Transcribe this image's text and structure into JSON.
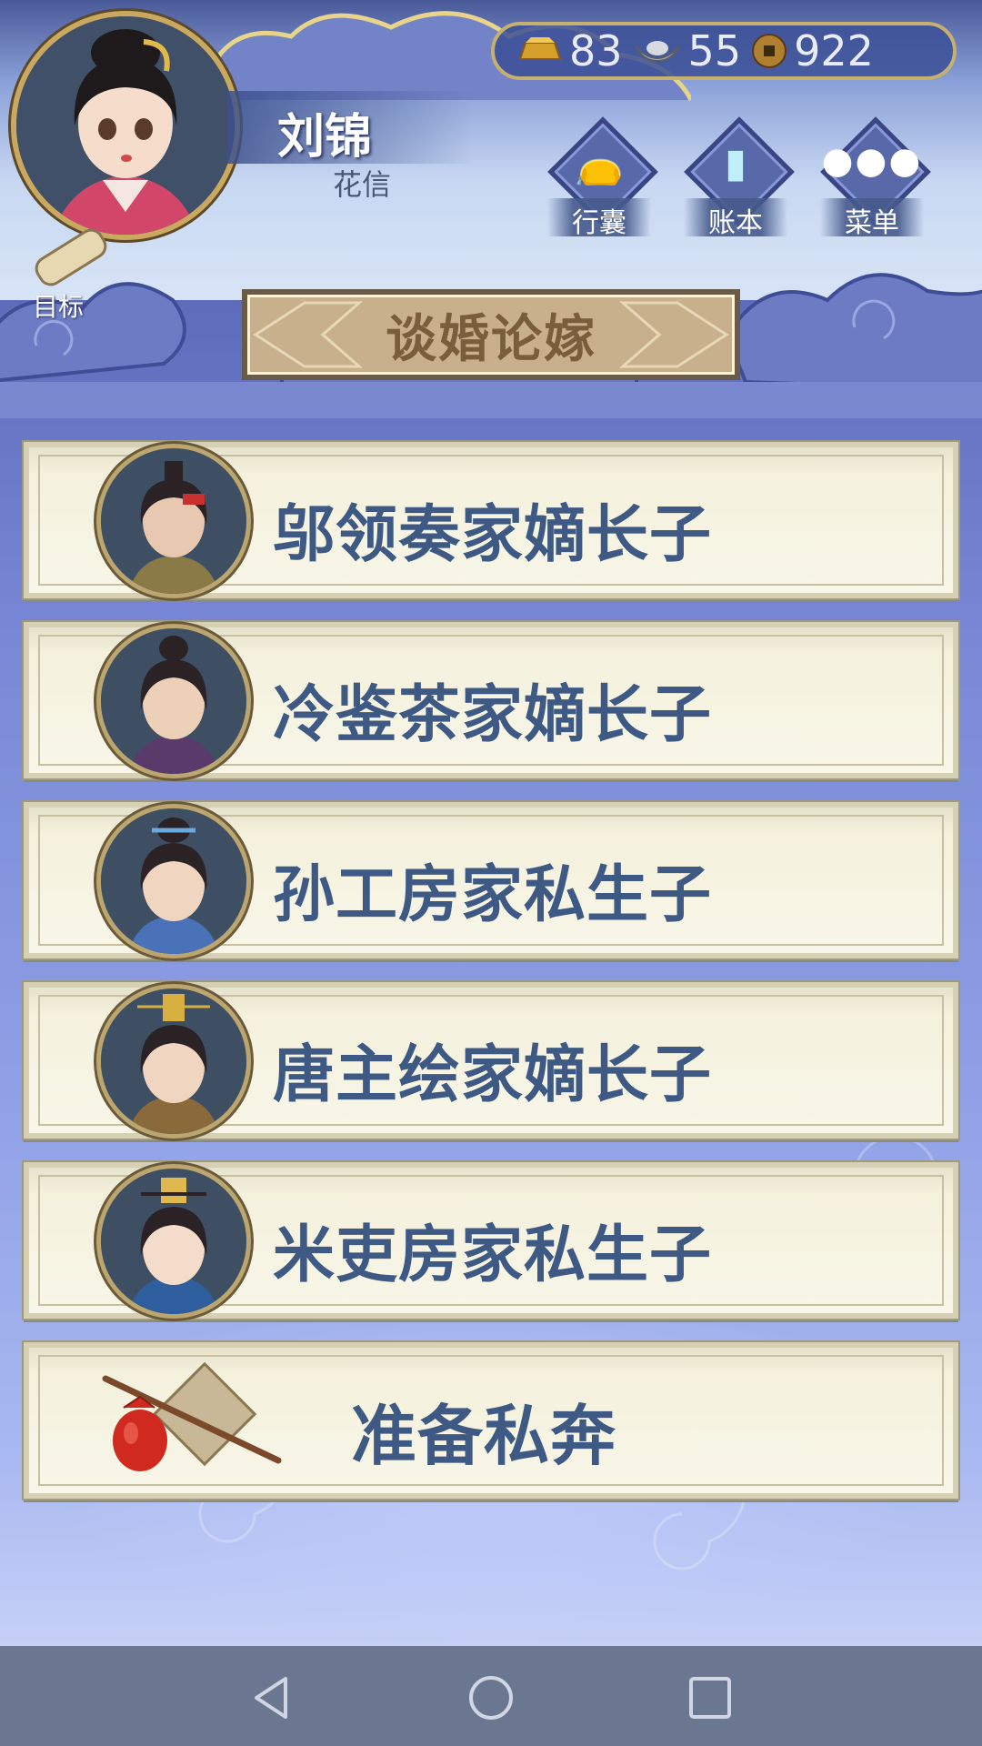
{
  "player": {
    "name": "刘锦",
    "title": "花信"
  },
  "currency": {
    "gold": "83",
    "silver": "55",
    "copper": "922"
  },
  "top_buttons": [
    {
      "label": "行囊",
      "icon": "bag-icon"
    },
    {
      "label": "账本",
      "icon": "ledger-icon"
    },
    {
      "label": "菜单",
      "icon": "menu-dots-icon"
    }
  ],
  "goal": {
    "label": "目标",
    "icon": "scroll-icon"
  },
  "screen_title": "谈婚论嫁",
  "candidates": [
    {
      "name": "邬领奏家嫡长子"
    },
    {
      "name": "冷鉴茶家嫡长子"
    },
    {
      "name": "孙工房家私生子"
    },
    {
      "name": "唐主绘家嫡长子"
    },
    {
      "name": "米吏房家私生子"
    }
  ],
  "elope": {
    "label": "准备私奔",
    "icon": "bundle-icon"
  },
  "nav": [
    "back-icon",
    "home-icon",
    "recents-icon"
  ]
}
